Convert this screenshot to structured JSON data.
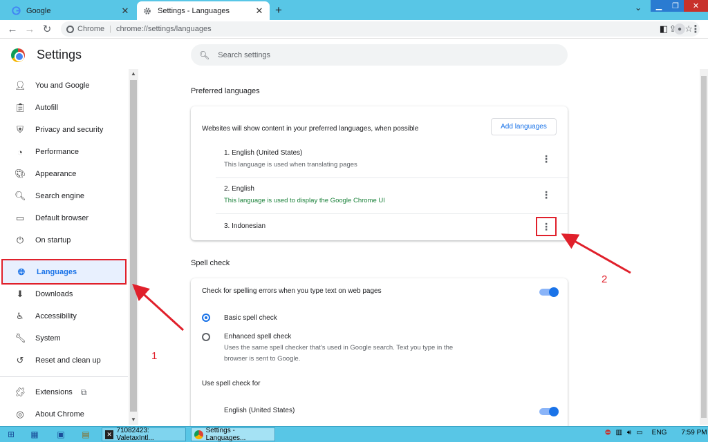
{
  "tabs": [
    {
      "title": "Google",
      "icon": "google-g-icon"
    },
    {
      "title": "Settings - Languages",
      "icon": "gear-icon"
    }
  ],
  "omnibox": {
    "chip": "Chrome",
    "url": "chrome://settings/languages"
  },
  "header": {
    "title": "Settings",
    "search_placeholder": "Search settings"
  },
  "sidebar": {
    "items": [
      {
        "label": "You and Google",
        "icon": "person-icon"
      },
      {
        "label": "Autofill",
        "icon": "clipboard-icon"
      },
      {
        "label": "Privacy and security",
        "icon": "shield-icon"
      },
      {
        "label": "Performance",
        "icon": "speedometer-icon"
      },
      {
        "label": "Appearance",
        "icon": "palette-icon"
      },
      {
        "label": "Search engine",
        "icon": "search-icon"
      },
      {
        "label": "Default browser",
        "icon": "browser-icon"
      },
      {
        "label": "On startup",
        "icon": "power-icon"
      },
      {
        "label": "Languages",
        "icon": "globe-icon",
        "selected": true
      },
      {
        "label": "Downloads",
        "icon": "download-icon"
      },
      {
        "label": "Accessibility",
        "icon": "accessibility-icon"
      },
      {
        "label": "System",
        "icon": "wrench-icon"
      },
      {
        "label": "Reset and clean up",
        "icon": "reset-icon"
      },
      {
        "label": "Extensions",
        "icon": "puzzle-icon"
      },
      {
        "label": "About Chrome",
        "icon": "chrome-icon"
      }
    ]
  },
  "preferred": {
    "title": "Preferred languages",
    "description": "Websites will show content in your preferred languages, when possible",
    "add_button": "Add languages",
    "languages": [
      {
        "name": "1. English (United States)",
        "note": "This language is used when translating pages"
      },
      {
        "name": "2. English",
        "note": "This language is used to display the Google Chrome UI"
      },
      {
        "name": "3. Indonesian",
        "note": ""
      }
    ]
  },
  "spell": {
    "title": "Spell check",
    "toggle_label": "Check for spelling errors when you type text on web pages",
    "basic": "Basic spell check",
    "enhanced": "Enhanced spell check",
    "enhanced_desc_1": "Uses the same spell checker that's used in Google search. Text you type in the",
    "enhanced_desc_2": "browser is sent to Google.",
    "use_for": "Use spell check for",
    "lang": "English (United States)"
  },
  "annotations": {
    "one": "1",
    "two": "2",
    "color": "#e0202b"
  },
  "taskbar": {
    "apps": [
      {
        "label": "71082423: ValetaxIntl..."
      },
      {
        "label": "Settings - Languages..."
      }
    ],
    "lang": "ENG",
    "time": "7:59 PM"
  },
  "colors": {
    "accent": "#1a73e8",
    "titlebar": "#58c6e6",
    "annotation": "#e0202b"
  }
}
